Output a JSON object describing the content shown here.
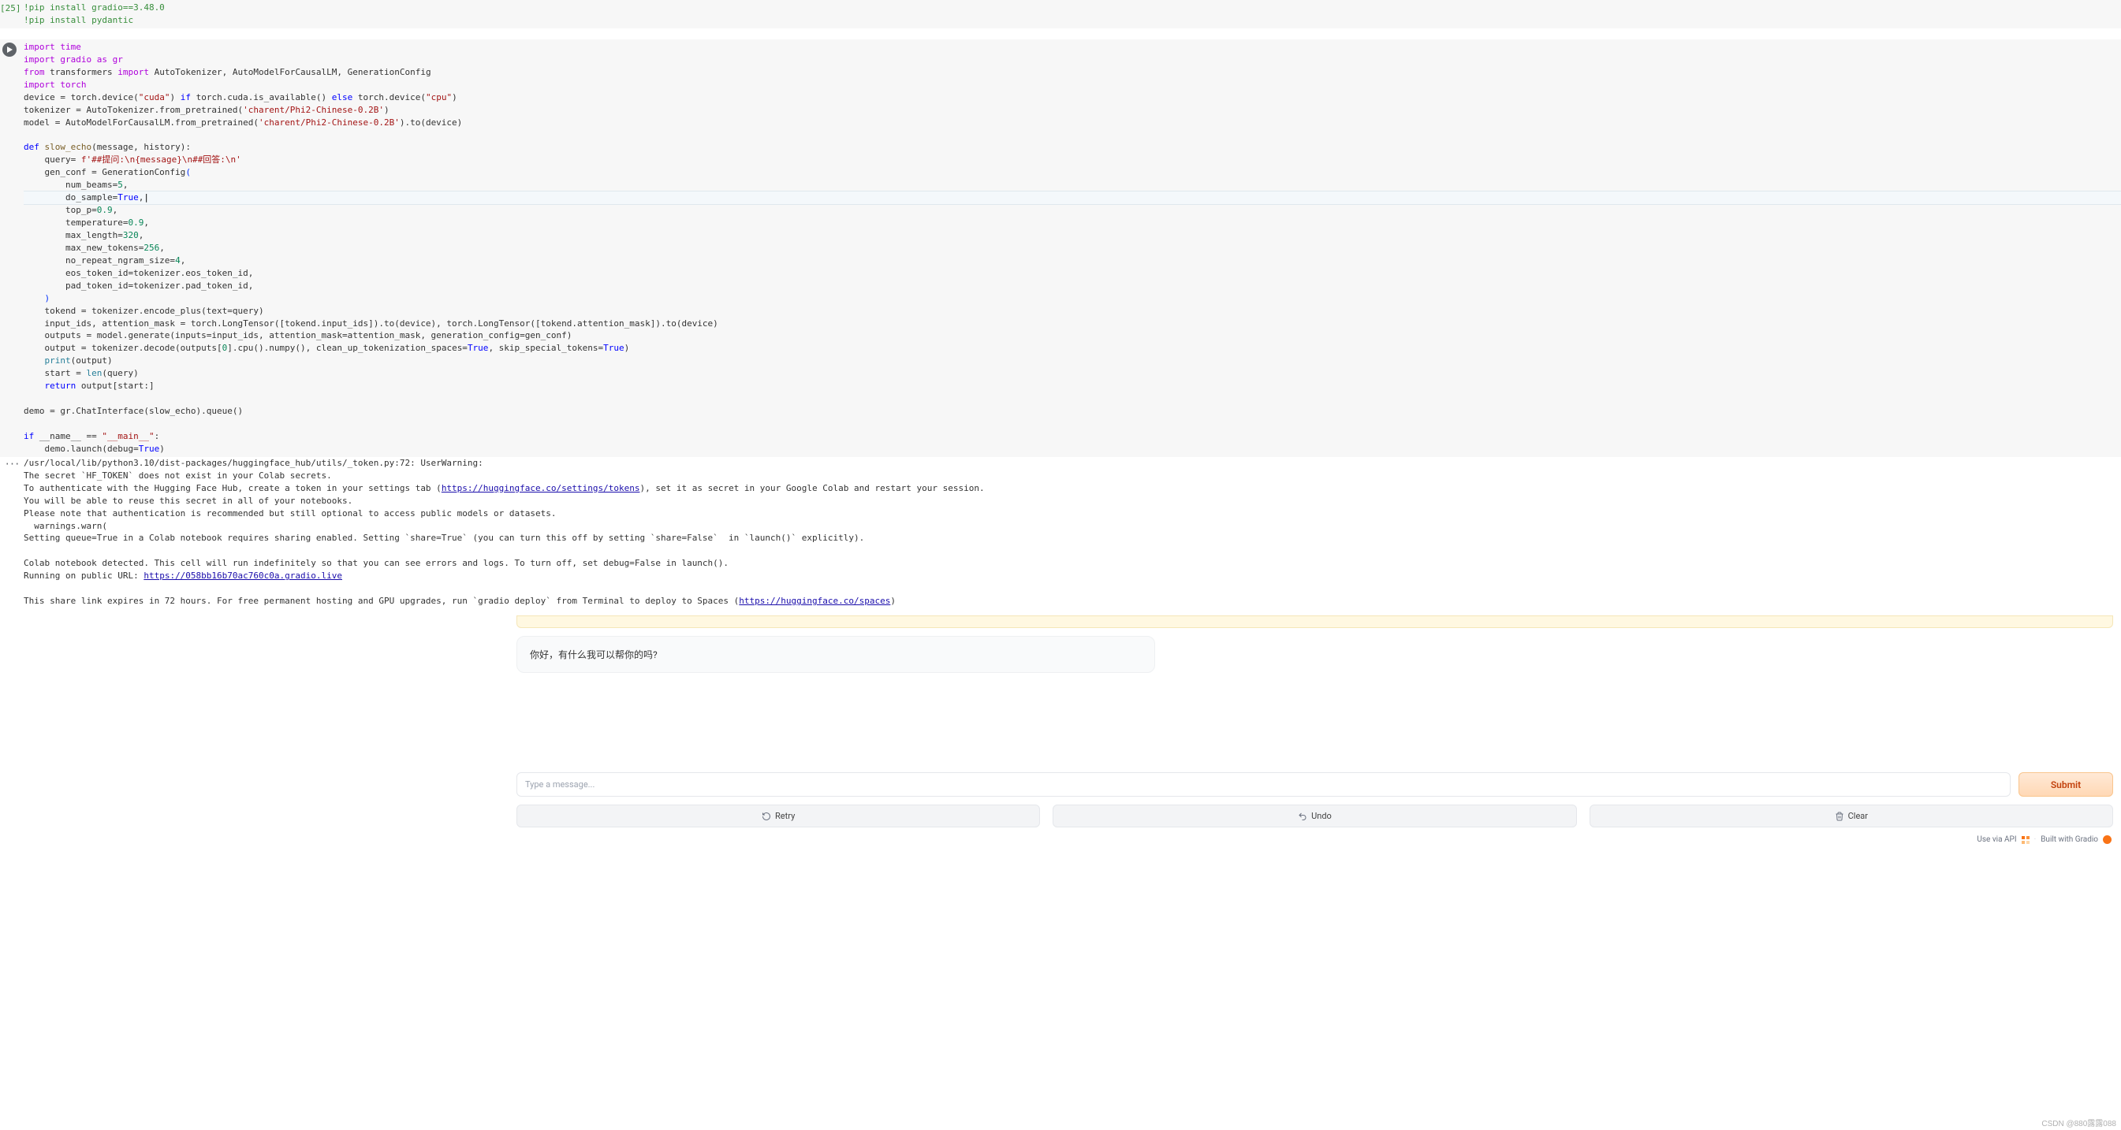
{
  "cell1": {
    "exec_label": "[25]",
    "lines": [
      "!pip install gradio==3.48.0",
      "!pip install pydantic"
    ]
  },
  "cell2": {
    "lines": {
      "l0": "import time",
      "l1": "import gradio as gr",
      "l2_a": "from",
      "l2_b": " transformers ",
      "l2_c": "import",
      "l2_d": " AutoTokenizer, AutoModelForCausalLM, GenerationConfig",
      "l3": "import torch",
      "l4_a": "device = torch.device(",
      "l4_b": "\"cuda\"",
      "l4_c": ") ",
      "l4_d": "if",
      "l4_e": " torch.cuda.is_available() ",
      "l4_f": "else",
      "l4_g": " torch.device(",
      "l4_h": "\"cpu\"",
      "l4_i": ")",
      "l5_a": "tokenizer = AutoTokenizer.from_pretrained(",
      "l5_b": "'charent/Phi2-Chinese-0.2B'",
      "l5_c": ")",
      "l6_a": "model = AutoModelForCausalLM.from_pretrained(",
      "l6_b": "'charent/Phi2-Chinese-0.2B'",
      "l6_c": ").to(device)",
      "l7": "",
      "l8_a": "def",
      "l8_b": " ",
      "l8_c": "slow_echo",
      "l8_d": "(message, history):",
      "l9_a": "    query= ",
      "l9_b": "f'##提问:\\n{message}\\n##回答:\\n'",
      "l10_a": "    gen_conf = GenerationConfig",
      "l10_b": "(",
      "l11_a": "        num_beams=",
      "l11_b": "5",
      "l11_c": ",",
      "l12_a": "        do_sample=",
      "l12_b": "True",
      "l12_c": ",",
      "l13_a": "        top_p=",
      "l13_b": "0.9",
      "l13_c": ",",
      "l14_a": "        temperature=",
      "l14_b": "0.9",
      "l14_c": ",",
      "l15_a": "        max_length=",
      "l15_b": "320",
      "l15_c": ",",
      "l16_a": "        max_new_tokens=",
      "l16_b": "256",
      "l16_c": ",",
      "l17_a": "        no_repeat_ngram_size=",
      "l17_b": "4",
      "l17_c": ",",
      "l18": "        eos_token_id=tokenizer.eos_token_id,",
      "l19": "        pad_token_id=tokenizer.pad_token_id,",
      "l20": "    )",
      "l21_a": "    tokend = tokenizer.encode_plus(text=query)",
      "l22_a": "    input_ids, attention_mask = torch.LongTensor([tokend.input_ids]).to(device), torch.LongTensor([tokend.attention_mask]).to(device)",
      "l23_a": "    outputs = model.generate(inputs=input_ids, attention_mask=attention_mask, generation_config=gen_conf)",
      "l24_a": "    output = tokenizer.decode(outputs[",
      "l24_b": "0",
      "l24_c": "].cpu().numpy(), clean_up_tokenization_spaces=",
      "l24_d": "True",
      "l24_e": ", skip_special_tokens=",
      "l24_f": "True",
      "l24_g": ")",
      "l25_a": "    ",
      "l25_b": "print",
      "l25_c": "(output)",
      "l26_a": "    start = ",
      "l26_b": "len",
      "l26_c": "(query)",
      "l27_a": "    ",
      "l27_b": "return",
      "l27_c": " output[start:]",
      "l28": "",
      "l29": "demo = gr.ChatInterface(slow_echo).queue()",
      "l30": "",
      "l31_a": "if",
      "l31_b": " __name__ == ",
      "l31_c": "\"__main__\"",
      "l31_d": ":",
      "l32_a": "    demo.launch(debug=",
      "l32_b": "True",
      "l32_c": ")"
    }
  },
  "output": {
    "dots": "···",
    "line1": "/usr/local/lib/python3.10/dist-packages/huggingface_hub/utils/_token.py:72: UserWarning:",
    "line2": "The secret `HF_TOKEN` does not exist in your Colab secrets.",
    "line3a": "To authenticate with the Hugging Face Hub, create a token in your settings tab (",
    "line3_link": "https://huggingface.co/settings/tokens",
    "line3b": "), set it as secret in your Google Colab and restart your session.",
    "line4": "You will be able to reuse this secret in all of your notebooks.",
    "line5": "Please note that authentication is recommended but still optional to access public models or datasets.",
    "line6": "  warnings.warn(",
    "line7": "Setting queue=True in a Colab notebook requires sharing enabled. Setting `share=True` (you can turn this off by setting `share=False`  in `launch()` explicitly).",
    "line8": "",
    "line9": "Colab notebook detected. This cell will run indefinitely so that you can see errors and logs. To turn off, set debug=False in launch().",
    "line10a": "Running on public URL: ",
    "line10_link": "https://058bb16b70ac760c0a.gradio.live",
    "line11": "",
    "line12a": "This share link expires in 72 hours. For free permanent hosting and GPU upgrades, run `gradio deploy` from Terminal to deploy to Spaces (",
    "line12_link": "https://huggingface.co/spaces",
    "line12b": ")"
  },
  "gradio": {
    "bot_message": "你好，有什么我可以帮你的吗?",
    "placeholder": "Type a message...",
    "submit": "Submit",
    "retry": "Retry",
    "undo": "Undo",
    "clear": "Clear",
    "use_api": "Use via API",
    "built_with": "Built with Gradio",
    "dot": "·"
  },
  "watermark": "CSDN @880露露088"
}
